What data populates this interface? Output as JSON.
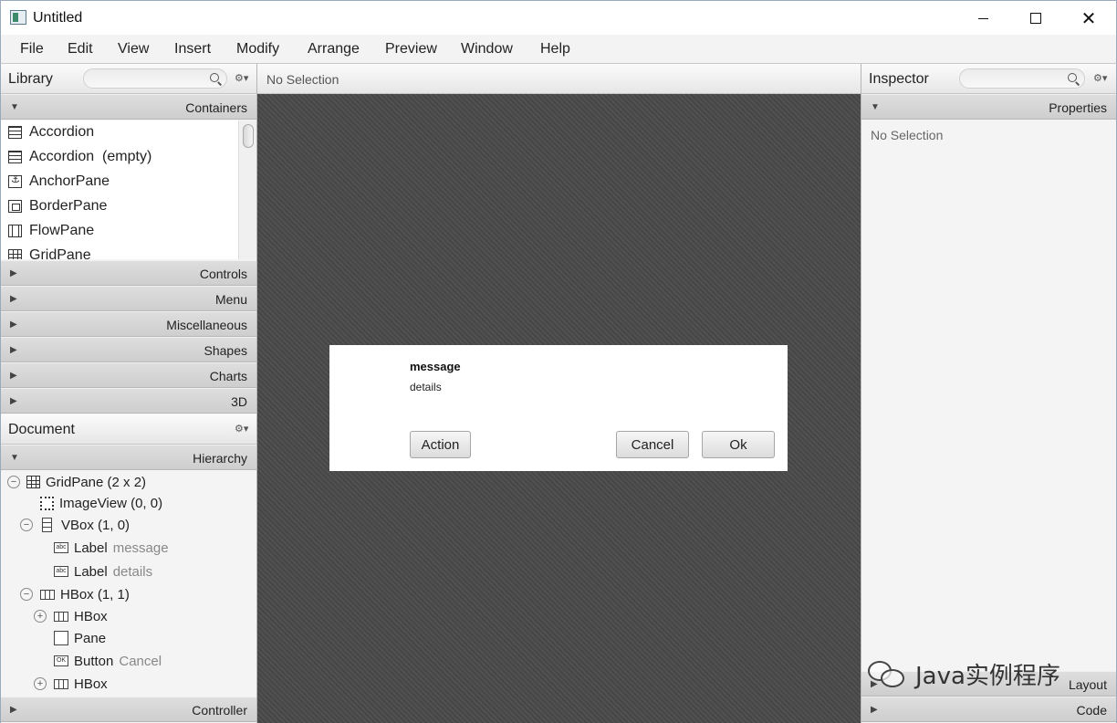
{
  "window": {
    "title": "Untitled",
    "minimize": "",
    "maximize": "",
    "close": "✕"
  },
  "menu": [
    "File",
    "Edit",
    "View",
    "Insert",
    "Modify",
    "Arrange",
    "Preview",
    "Window",
    "Help"
  ],
  "library": {
    "title": "Library",
    "gear": "⚙▾",
    "containers_label": "Containers",
    "items": [
      {
        "label": "Accordion",
        "icon": "accordion-icon"
      },
      {
        "label": "Accordion  (empty)",
        "icon": "accordion-icon"
      },
      {
        "label": "AnchorPane",
        "icon": "anchor-pane-icon"
      },
      {
        "label": "BorderPane",
        "icon": "border-pane-icon"
      },
      {
        "label": "FlowPane",
        "icon": "flow-pane-icon"
      },
      {
        "label": "GridPane",
        "icon": "grid-pane-icon"
      }
    ],
    "sections": [
      "Controls",
      "Menu",
      "Miscellaneous",
      "Shapes",
      "Charts",
      "3D"
    ]
  },
  "document": {
    "title": "Document",
    "gear": "⚙▾",
    "hierarchy_label": "Hierarchy",
    "controller_label": "Controller",
    "tree": [
      {
        "toggle": "−",
        "label": "GridPane (2 x 2)",
        "extra": ""
      },
      {
        "toggle": "",
        "label": "ImageView (0, 0)",
        "extra": ""
      },
      {
        "toggle": "−",
        "label": "VBox (1, 0)",
        "extra": ""
      },
      {
        "toggle": "",
        "label": "Label",
        "extra": "message"
      },
      {
        "toggle": "",
        "label": "Label",
        "extra": "details"
      },
      {
        "toggle": "−",
        "label": "HBox (1, 1)",
        "extra": ""
      },
      {
        "toggle": "+",
        "label": "HBox",
        "extra": ""
      },
      {
        "toggle": "",
        "label": "Pane",
        "extra": ""
      },
      {
        "toggle": "",
        "label": "Button",
        "extra": "Cancel"
      },
      {
        "toggle": "+",
        "label": "HBox",
        "extra": ""
      }
    ],
    "icon_labels": {
      "abc": "abc",
      "ok": "OK"
    }
  },
  "center": {
    "selection": "No Selection",
    "dialog": {
      "message": "message",
      "details": "details",
      "action_label": "Action",
      "cancel_label": "Cancel",
      "ok_label": "Ok"
    }
  },
  "inspector": {
    "title": "Inspector",
    "gear": "⚙▾",
    "properties_label": "Properties",
    "no_selection": "No Selection",
    "layout_label": "Layout",
    "code_label": "Code"
  },
  "watermark": {
    "text": "Java实例程序"
  }
}
